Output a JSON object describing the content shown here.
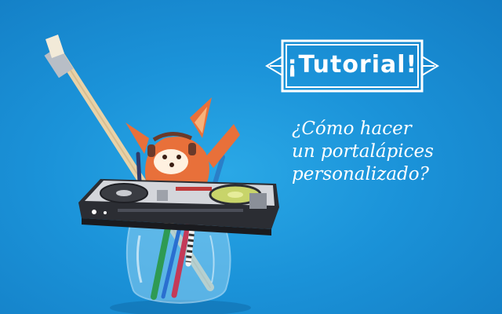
{
  "banner": {
    "title": "¡Tutorial!"
  },
  "subtitle": {
    "line1": "¿Cómo hacer",
    "line2": "un portalápices",
    "line3": "personalizado?"
  },
  "colors": {
    "background": "#1b93d9",
    "text": "#ffffff",
    "fox": "#e8703a",
    "deck_slider": "#c03a3a",
    "deck_disc": "#c8d46a"
  }
}
